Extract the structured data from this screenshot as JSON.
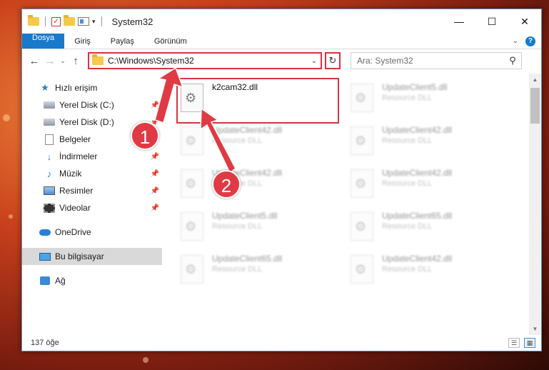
{
  "window": {
    "title": "System32"
  },
  "window_controls": {
    "minimize": "—",
    "maximize": "☐",
    "close": "✕"
  },
  "ribbon": {
    "tabs": [
      "Dosya",
      "Giriş",
      "Paylaş",
      "Görünüm"
    ]
  },
  "address": {
    "path": "C:\\Windows\\System32"
  },
  "search": {
    "placeholder": "Ara: System32"
  },
  "sidebar": {
    "items": [
      {
        "label": "Hızlı erişim",
        "icon": "star-icon"
      },
      {
        "label": "Yerel Disk (C:)",
        "icon": "disk-icon",
        "pinned": true
      },
      {
        "label": "Yerel Disk (D:)",
        "icon": "disk-icon",
        "pinned": true
      },
      {
        "label": "Belgeler",
        "icon": "documents-icon",
        "pinned": true
      },
      {
        "label": "İndirmeler",
        "icon": "download-icon",
        "pinned": true
      },
      {
        "label": "Müzik",
        "icon": "music-icon",
        "pinned": true
      },
      {
        "label": "Resimler",
        "icon": "pictures-icon",
        "pinned": true
      },
      {
        "label": "Videolar",
        "icon": "videos-icon",
        "pinned": true
      },
      {
        "label": "OneDrive",
        "icon": "onedrive-icon"
      },
      {
        "label": "Bu bilgisayar",
        "icon": "this-pc-icon",
        "selected": true
      },
      {
        "label": "Ağ",
        "icon": "network-icon"
      }
    ]
  },
  "files": [
    {
      "name": "k2cam32.dll",
      "type": "",
      "highlighted": true
    },
    {
      "name": "UpdateClient5.dll",
      "type": "Resource DLL"
    },
    {
      "name": "UpdateClient42.dll",
      "type": "Resource DLL"
    },
    {
      "name": "UpdateClient42.dll",
      "type": "Resource DLL"
    },
    {
      "name": "UpdateClient42.dll",
      "type": "Resource DLL"
    },
    {
      "name": "UpdateClient42.dll",
      "type": "Resource DLL"
    },
    {
      "name": "UpdateClient5.dll",
      "type": "Resource DLL"
    },
    {
      "name": "UpdateClient65.dll",
      "type": "Resource DLL"
    },
    {
      "name": "UpdateClient65.dll",
      "type": "Resource DLL"
    },
    {
      "name": "UpdateClient42.dll",
      "type": "Resource DLL"
    }
  ],
  "status": {
    "count": "137 öğe"
  },
  "annotations": {
    "step1": "1",
    "step2": "2",
    "color": "#e03a45"
  }
}
